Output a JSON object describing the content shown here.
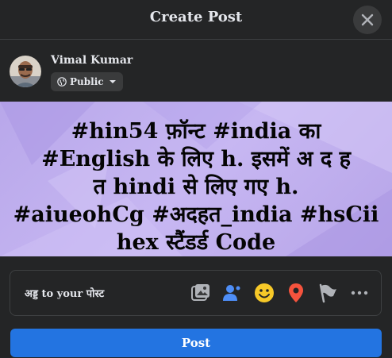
{
  "header": {
    "title": "Create Post"
  },
  "user": {
    "name": "Vimal Kumar",
    "privacy": "Public"
  },
  "post": {
    "lines": [
      "#hin54 फ़ॉन्ट #india का",
      "#English के लिए h. इसमें अ द ह",
      "त hindi से लिए गए h.",
      "#aiueohCg #अदहत_india #hsCii",
      "hex स्टैंडर्ड Code"
    ]
  },
  "add_to_post": {
    "label": "अड्ड to your पोस्ट",
    "tools": [
      "photo-video",
      "tag-people",
      "feeling-activity",
      "check-in",
      "live-video",
      "more-options"
    ]
  },
  "post_button": "Post",
  "colors": {
    "accent": "#2374e1",
    "background": "#242526",
    "canvas": "#c2b1f0"
  }
}
